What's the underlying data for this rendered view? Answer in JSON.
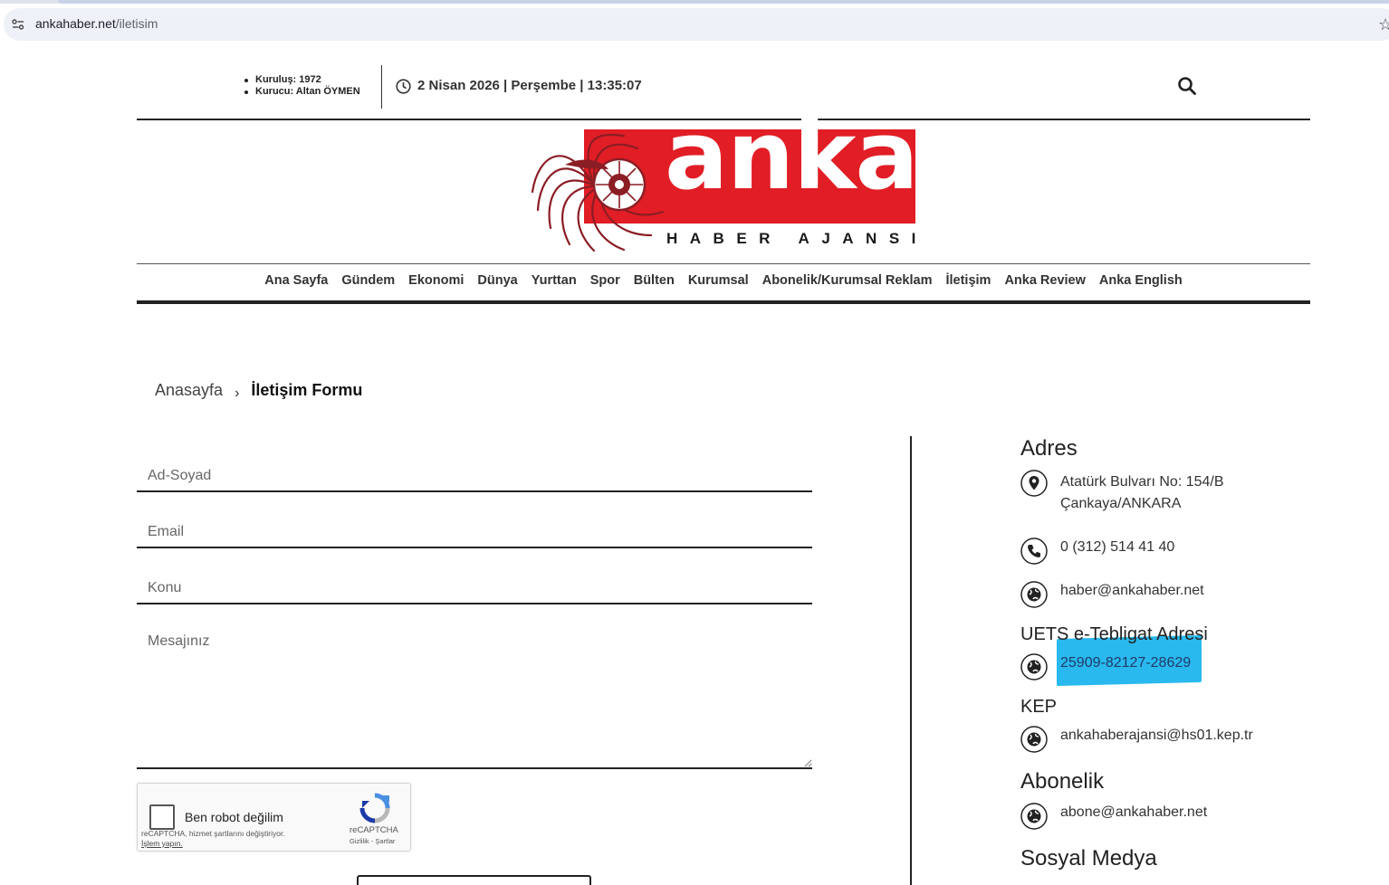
{
  "browser": {
    "url_host": "ankahaber.net",
    "url_path": "/iletisim"
  },
  "topbar": {
    "founded": "Kuruluş: 1972",
    "founder": "Kurucu: Altan ÖYMEN",
    "datetime": "2 Nisan 2026 | Perşembe | 13:35:07"
  },
  "logo": {
    "word": "anka",
    "tagline": "HABER AJANSI",
    "color_red": "#e11d25",
    "color_dark_red": "#8b1d24"
  },
  "nav": {
    "items": [
      "Ana Sayfa",
      "Gündem",
      "Ekonomi",
      "Dünya",
      "Yurttan",
      "Spor",
      "Bülten",
      "Kurumsal",
      "Abonelik/Kurumsal Reklam",
      "İletişim",
      "Anka Review",
      "Anka English"
    ]
  },
  "breadcrumb": {
    "home": "Anasayfa",
    "separator": "›",
    "current": "İletişim Formu"
  },
  "form": {
    "name_placeholder": "Ad-Soyad",
    "email_placeholder": "Email",
    "subject_placeholder": "Konu",
    "message_placeholder": "Mesajınız"
  },
  "captcha": {
    "label": "Ben robot değilim",
    "notice": "reCAPTCHA, hizmet şartlarını değiştiriyor.",
    "notice_link": "İşlem yapın.",
    "brand": "reCAPTCHA",
    "links": "Gizlilik - Şartlar"
  },
  "contact": {
    "address_heading": "Adres",
    "address_line1": "Atatürk Bulvarı No: 154/B",
    "address_line2": "Çankaya/ANKARA",
    "phone": "0 (312) 514 41 40",
    "email": "haber@ankahaber.net",
    "uets_heading": "UETS e-Tebligat Adresi",
    "uets_value": "25909-82127-28629",
    "kep_heading": "KEP",
    "kep_value": "ankahaberajansi@hs01.kep.tr",
    "subscription_heading": "Abonelik",
    "subscription_email": "abone@ankahaber.net",
    "social_heading": "Sosyal Medya",
    "highlight_color": "#29b9ef"
  }
}
